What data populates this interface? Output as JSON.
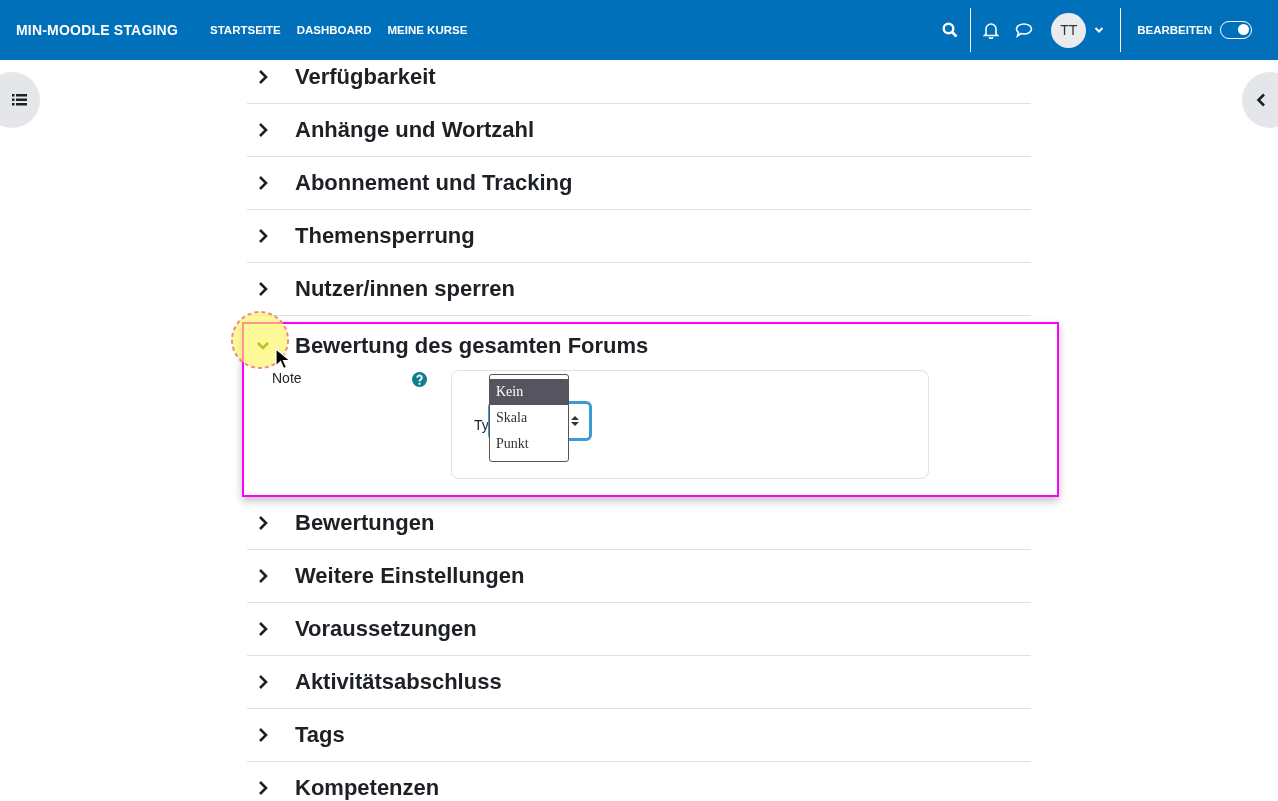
{
  "header": {
    "site_name": "MIN-MOODLE STAGING",
    "nav": [
      "STARTSEITE",
      "DASHBOARD",
      "MEINE KURSE"
    ],
    "avatar": "TT",
    "edit_label": "BEARBEITEN",
    "edit_on": true
  },
  "sections": [
    {
      "title": "Verfügbarkeit",
      "expanded": false
    },
    {
      "title": "Anhänge und Wortzahl",
      "expanded": false
    },
    {
      "title": "Abonnement und Tracking",
      "expanded": false
    },
    {
      "title": "Themensperrung",
      "expanded": false
    },
    {
      "title": "Nutzer/innen sperren",
      "expanded": false
    },
    {
      "title": "Bewertung des gesamten Forums",
      "expanded": true,
      "field": {
        "label": "Note",
        "group_label": "Ty",
        "options": [
          {
            "label": "Kein",
            "selected": true
          },
          {
            "label": "Skala",
            "selected": false
          },
          {
            "label": "Punkt",
            "selected": false
          }
        ]
      }
    },
    {
      "title": "Bewertungen",
      "expanded": false
    },
    {
      "title": "Weitere Einstellungen",
      "expanded": false
    },
    {
      "title": "Voraussetzungen",
      "expanded": false
    },
    {
      "title": "Aktivitätsabschluss",
      "expanded": false
    },
    {
      "title": "Tags",
      "expanded": false
    },
    {
      "title": "Kompetenzen",
      "expanded": false
    }
  ]
}
